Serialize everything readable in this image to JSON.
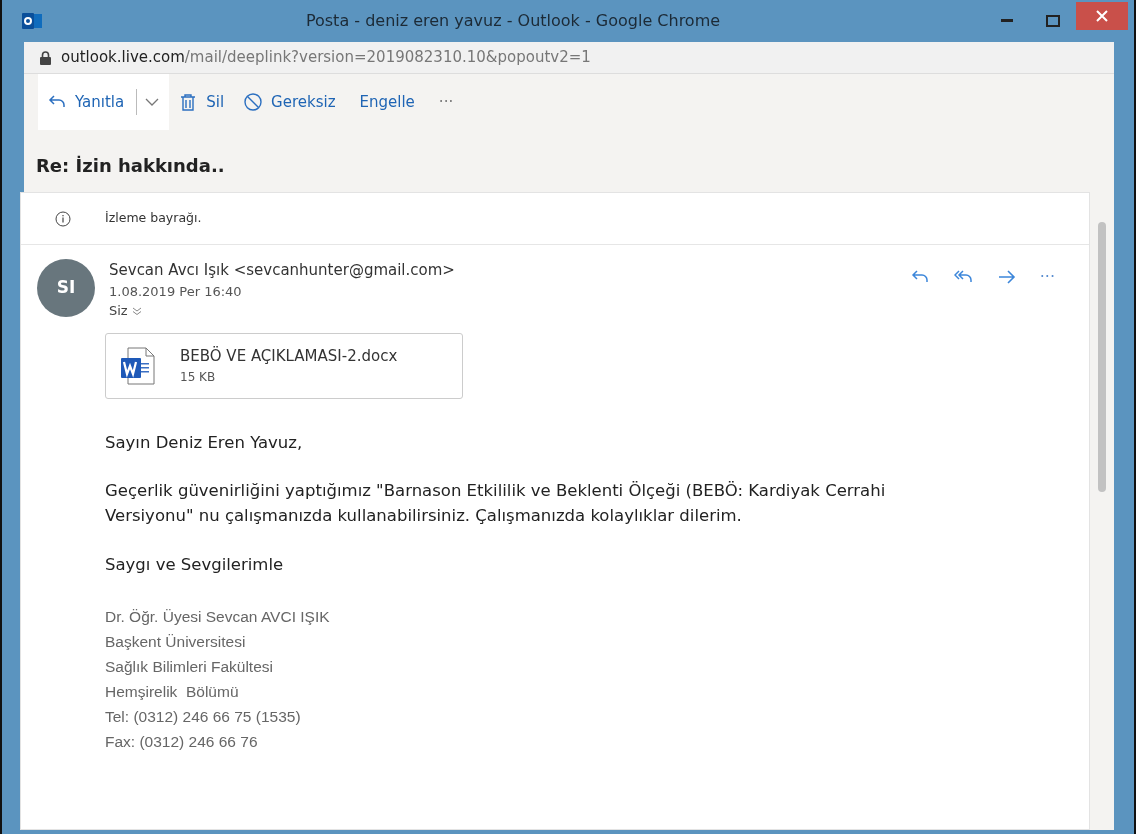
{
  "window": {
    "title": "Posta - deniz eren yavuz - Outlook - Google Chrome"
  },
  "address_bar": {
    "host": "outlook.live.com",
    "path": "/mail/deeplink?version=2019082310.10&popoutv2=1"
  },
  "toolbar": [
    {
      "kind": "reply",
      "label": "Yanıtla"
    },
    {
      "kind": "delete",
      "label": "Sil"
    },
    {
      "kind": "junk",
      "label": "Gereksiz"
    },
    {
      "kind": "block",
      "label": "Engelle"
    },
    {
      "kind": "more",
      "label": "···"
    }
  ],
  "subject": "Re: İzin hakkında..",
  "info_bar": {
    "text": "İzleme bayrağı."
  },
  "message": {
    "avatar": "SI",
    "sender": "Sevcan Avcı Işık <sevcanhunter@gmail.com>",
    "date": "1.08.2019 Per 16:40",
    "to": "Siz",
    "actions": [
      {
        "kind": "reply"
      },
      {
        "kind": "reply_all"
      },
      {
        "kind": "forward"
      },
      {
        "kind": "more",
        "label": "···"
      }
    ],
    "attachment": {
      "name": "BEBÖ VE AÇIKLAMASI-2.docx",
      "size": "15 KB"
    },
    "body": [
      "Sayın Deniz Eren Yavuz,",
      "Geçerlik güvenirliğini yaptığımız \"Barnason Etkililik ve Beklenti Ölçeği (BEBÖ: Kardiyak Cerrahi Versiyonu\" nu çalışmanızda kullanabilirsiniz. Çalışmanızda kolaylıklar dilerim.",
      "Saygı ve Sevgilerimle"
    ],
    "signature": [
      "Dr. Öğr. Üyesi Sevcan AVCI IŞIK",
      "Başkent Üniversitesi",
      "Sağlık Bilimleri Fakültesi",
      "Hemşirelik  Bölümü",
      "Tel: (0312) 246 66 75 (1535)",
      "Fax: (0312) 246 66 76"
    ]
  }
}
